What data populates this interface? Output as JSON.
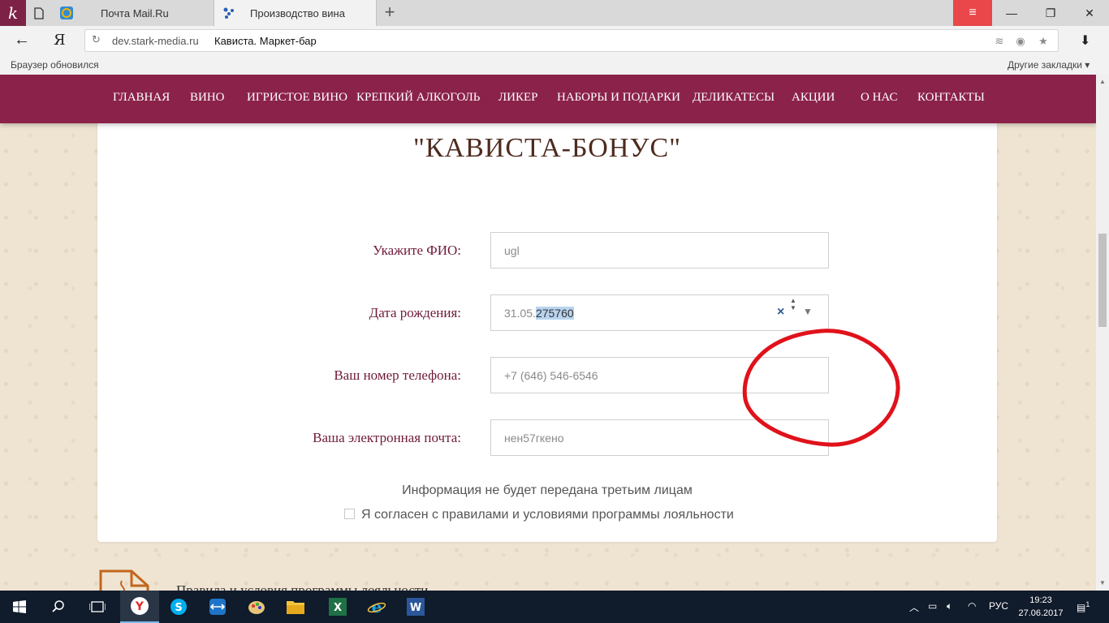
{
  "browser": {
    "tabs": [
      {
        "label": "Почта Mail.Ru",
        "icon": "mail-ru-icon"
      },
      {
        "label": "Производство вина",
        "icon": "star-dots-icon"
      }
    ],
    "address": {
      "host": "dev.stark-media.ru",
      "title": "Кависта. Маркет-бар"
    },
    "infobar": {
      "left": "Браузер обновился",
      "right": "Другие закладки"
    }
  },
  "nav": {
    "items": [
      "ГЛАВНАЯ",
      "ВИНО",
      "ИГРИСТОЕ ВИНО",
      "КРЕПКИЙ АЛКОГОЛЬ",
      "ЛИКЕР",
      "НАБОРЫ И ПОДАРКИ",
      "ДЕЛИКАТЕСЫ",
      "АКЦИИ",
      "О НАС",
      "КОНТАКТЫ"
    ]
  },
  "form": {
    "title": "\"КАВИСТА-БОНУС\"",
    "fio": {
      "label": "Укажите ФИО:",
      "value": "ugl"
    },
    "birth": {
      "label": "Дата рождения:",
      "value_prefix": "31.05.",
      "value_selected": "275760"
    },
    "phone": {
      "label": "Ваш номер телефона:",
      "value": "+7 (646) 546-6546"
    },
    "email": {
      "label": "Ваша электронная почта:",
      "value": "нен57гкено"
    },
    "info": "Информация не будет передана третьим лицам",
    "agree": "Я согласен с правилами и условиями программы лояльности",
    "rules_link": "Правила и условия программы лояльности"
  },
  "taskbar": {
    "lang": "РУС",
    "time": "19:23",
    "date": "27.06.2017",
    "notifications": "1"
  },
  "colors": {
    "nav": "#8b2249",
    "label": "#6f1a3b",
    "title": "#4e2b1f",
    "annotation": "#e0121b"
  }
}
